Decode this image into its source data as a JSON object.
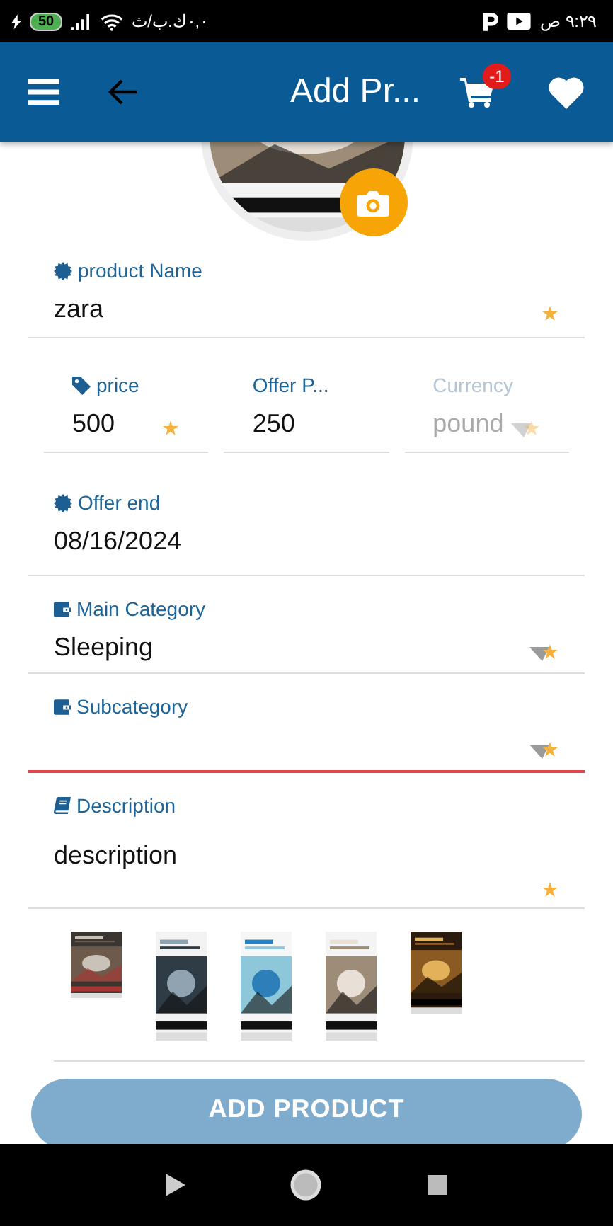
{
  "status_bar": {
    "data_speed": "٠,٠ك.ب/ث",
    "battery": "50",
    "time": "٩:٢٩ ص"
  },
  "app_bar": {
    "title": "Add Pr...",
    "cart_badge": "-1"
  },
  "form": {
    "product_name": {
      "label": "product Name",
      "value": "zara",
      "required": true
    },
    "price": {
      "label": "price",
      "value": "500",
      "required": true
    },
    "offer_price": {
      "label": "Offer P...",
      "value": "250",
      "required": false
    },
    "currency": {
      "label": "Currency",
      "value": "pound",
      "required": true,
      "disabled": true
    },
    "offer_end": {
      "label": "Offer end",
      "value": "08/16/2024",
      "required": false
    },
    "main_category": {
      "label": "Main Category",
      "value": "Sleeping",
      "required": true,
      "error": false
    },
    "subcategory": {
      "label": "Subcategory",
      "required": true,
      "error": true
    },
    "description": {
      "label": "Description",
      "value": "description",
      "required": true
    }
  },
  "submit_button": {
    "label": "ADD PRODUCT",
    "disabled": true
  }
}
